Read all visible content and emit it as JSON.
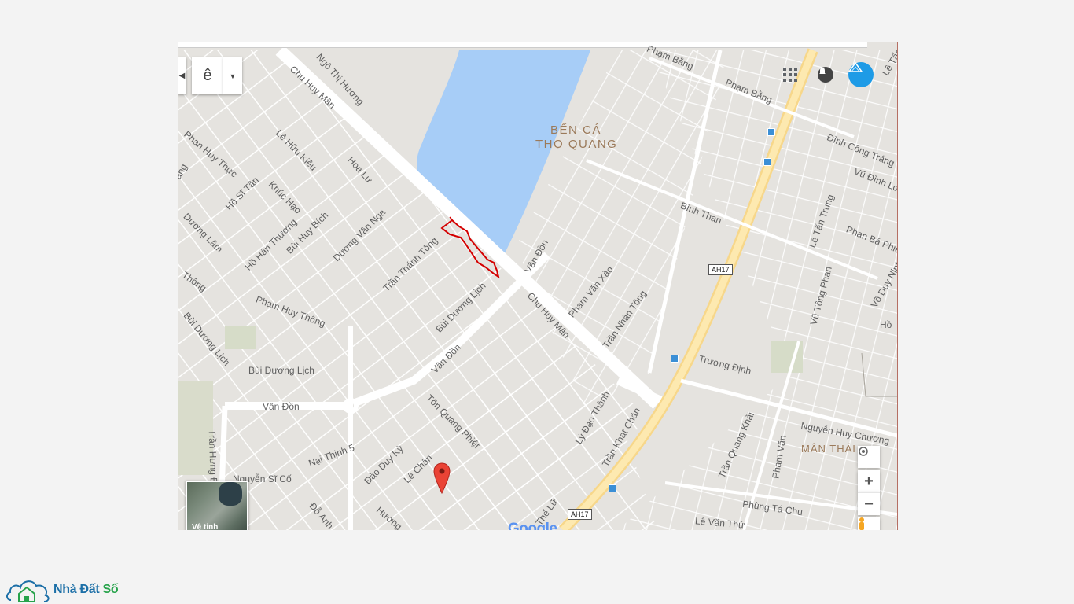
{
  "map": {
    "area_labels": [
      "BẾN CÁ",
      "THỌ QUANG",
      "MÂN THÁI"
    ],
    "street_labels": [
      "Chu Huy Mân",
      "Ngô Thị Hương",
      "Phạm Bằng",
      "Phạm Bằng",
      "Lê Tấn",
      "Lê Hữu Kiều",
      "Phan Huy Thực",
      "Hồ Sĩ Tân",
      "Khúc Hạo",
      "Hoa Lư",
      "Dương Lâm",
      "Hồ Hán Thương",
      "Bùi Huy Bích",
      "Dương Vân Nga",
      "Trần Thánh Tông",
      "Vân Đồn",
      "Phạm Văn Xảo",
      "Trần Nhân Tông",
      "Bình Than",
      "Đình Công Tráng",
      "Vũ Đình Long",
      "Lê Tấn Trung",
      "Phan Bá Phiến",
      "Võ Duy Ninh",
      "Vũ Tông Phan",
      "Phạm Huy Thông",
      "Bùi Dương Lịch",
      "Bùi Dương Lịch",
      "Bùi Dương Lịch",
      "Chu Huy Mân",
      "Vân Đồn",
      "Vân Đồn",
      "Trương Định",
      "Tôn Quang Phiệt",
      "Lý Đạo Thành",
      "Trần Khát Chân",
      "Nguyễn Huy Chương",
      "Trần Quang Khải",
      "Phạm Văn",
      "Trần Hưng Đ",
      "Nại Thịnh 5",
      "Đào Duy Kỳ",
      "Lê Chân",
      "Nguyễn Sĩ Cố",
      "Phùng Tá Chu",
      "Lê Văn Thứ",
      "Đỗ Anh",
      "Hương",
      "Thế Lữ",
      "Hồ",
      "Hồ",
      "Thông",
      "ang"
    ],
    "highway_shields": [
      "AH17",
      "AH17"
    ],
    "satellite_label": "Vệ tinh",
    "google_text": "Google",
    "colors": {
      "water": "#a7cdf7",
      "land": "#e5e3df",
      "road": "#ffffff",
      "highway": "#fde293",
      "parcel": "#d40000",
      "marker": "#ea4335"
    }
  },
  "toolbar": {
    "font_letter": "ê",
    "dropdown_icon": "caret-down-icon"
  },
  "header_icons": [
    "apps-grid-icon",
    "notification-bell-icon",
    "account-avatar-icon"
  ],
  "controls": {
    "locate_icon": "my-location-icon",
    "zoom_in": "+",
    "zoom_out": "−",
    "pegman_icon": "pegman-icon"
  },
  "brand": {
    "name_part1": "Nhà Đất ",
    "name_part2": "Số"
  }
}
